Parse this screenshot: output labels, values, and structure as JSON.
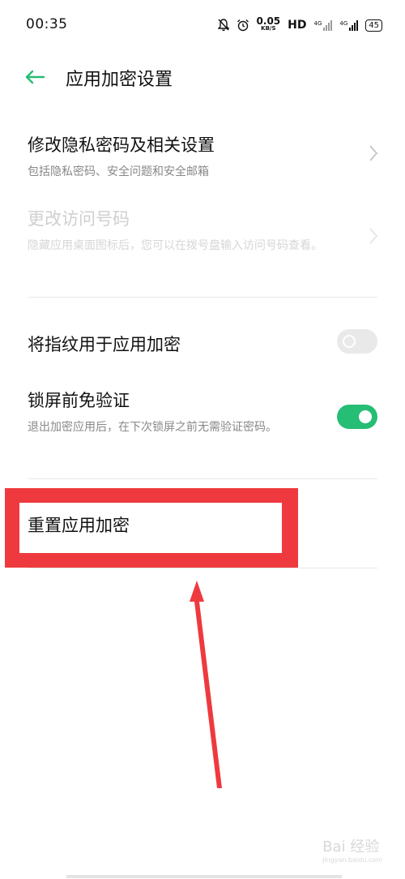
{
  "status_bar": {
    "time": "00:35",
    "speed_value": "0.05",
    "speed_unit": "KB/S",
    "hd": "HD",
    "net1": "4G",
    "net2": "4G",
    "battery": "45"
  },
  "app_bar": {
    "title": "应用加密设置",
    "accent": "#26bd74"
  },
  "settings": {
    "privacy": {
      "title": "修改隐私密码及相关设置",
      "subtitle": "包括隐私密码、安全问题和安全邮箱"
    },
    "access_code": {
      "title": "更改访问号码",
      "subtitle": "隐藏应用桌面图标后，您可以在拨号盘输入访问号码查看。",
      "enabled": false
    },
    "fingerprint": {
      "title": "将指纹用于应用加密",
      "toggle_on": false
    },
    "lockscreen": {
      "title": "锁屏前免验证",
      "subtitle": "退出加密应用后，在下次锁屏之前无需验证密码。",
      "toggle_on": true
    },
    "reset": {
      "title": "重置应用加密"
    }
  },
  "annotation": {
    "highlight_color": "#ee3a3f"
  },
  "watermark": {
    "text": "Bai 经验",
    "url": "jingyan.baidu.com"
  }
}
